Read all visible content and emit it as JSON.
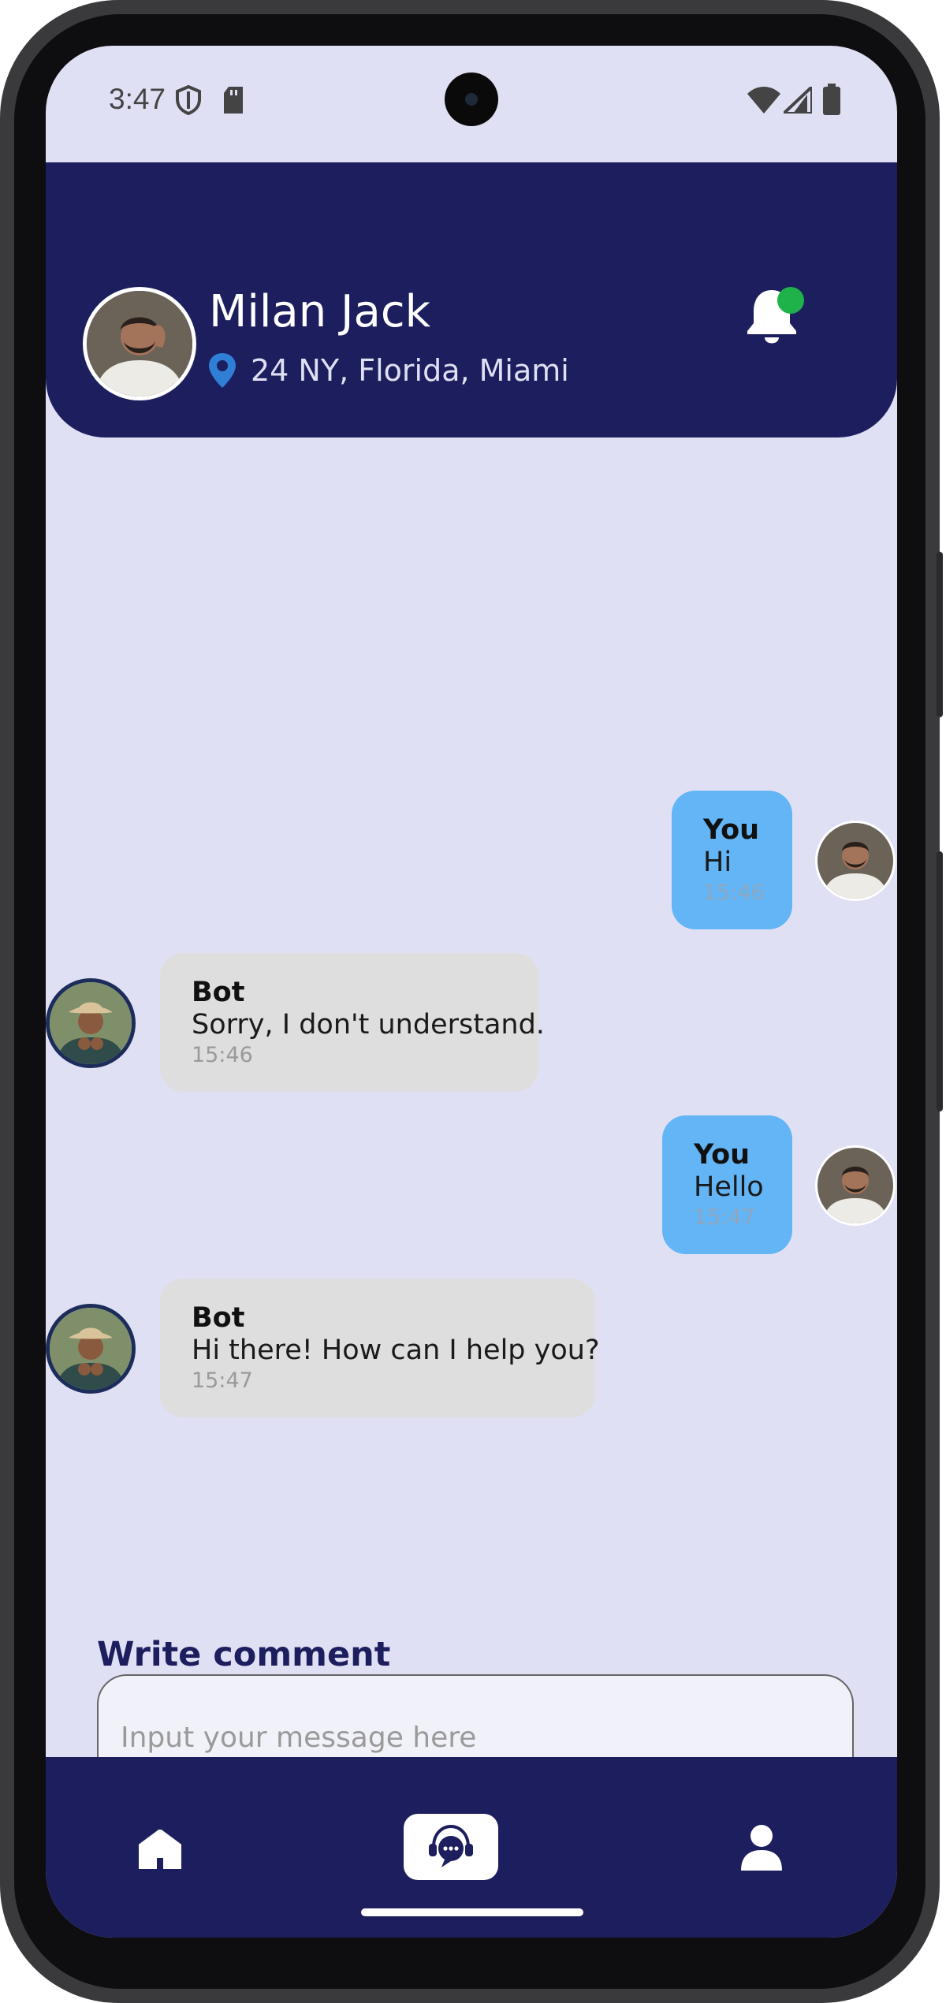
{
  "status_bar": {
    "time": "3:47",
    "icons_left": [
      "shield-icon",
      "sd-card-icon"
    ],
    "icons_right": [
      "wifi-icon",
      "signal-icon",
      "battery-icon"
    ]
  },
  "header": {
    "user_name": "Milan Jack",
    "location": "24 NY, Florida, Miami",
    "location_icon": "location-pin-icon",
    "notification_icon": "bell-icon",
    "notification_badge_color": "#1fb24b",
    "background_color": "#1c1e5e"
  },
  "messages": [
    {
      "sender": "You",
      "text": "Hi",
      "time": "15:46"
    },
    {
      "sender": "Bot",
      "text": "Sorry, I don't understand.",
      "time": "15:46"
    },
    {
      "sender": "You",
      "text": "Hello",
      "time": "15:47"
    },
    {
      "sender": "Bot",
      "text": "Hi there! How can I help you?",
      "time": "15:47"
    }
  ],
  "compose": {
    "label": "Write comment",
    "placeholder": "Input your message here"
  },
  "bottom_nav": {
    "items": [
      {
        "icon": "home-icon",
        "active": false
      },
      {
        "icon": "chat-support-icon",
        "active": true
      },
      {
        "icon": "profile-icon",
        "active": false
      }
    ]
  },
  "colors": {
    "screen_background": "#e0e0f4",
    "user_bubble": "#64b5f6",
    "bot_bubble": "#dedede",
    "accent": "#1c1e5e"
  }
}
